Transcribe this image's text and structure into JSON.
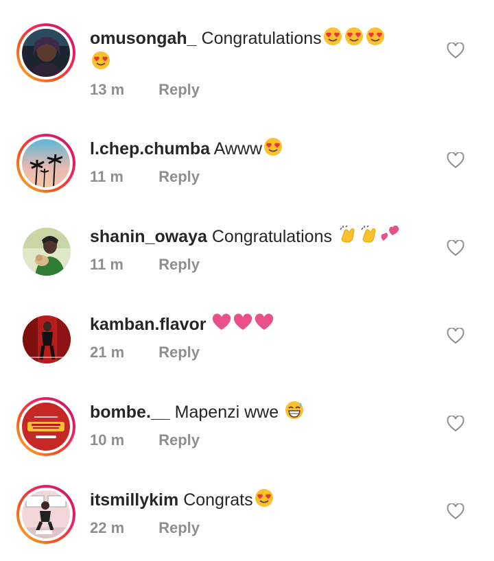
{
  "comments": [
    {
      "username": "omusongah_",
      "text": "Congratulations",
      "emojis": [
        "heart-eyes",
        "heart-eyes",
        "heart-eyes",
        "heart-eyes"
      ],
      "time": "13 m",
      "reply": "Reply",
      "avatar": "dark-portrait",
      "story_ring": true
    },
    {
      "username": "l.chep.chumba",
      "text": "Awww",
      "emojis": [
        "heart-eyes"
      ],
      "time": "11 m",
      "reply": "Reply",
      "avatar": "palm-trees-sunset",
      "story_ring": true
    },
    {
      "username": "shanin_owaya",
      "text": "Congratulations",
      "emojis": [
        "clapping-hands",
        "clapping-hands",
        "two-hearts"
      ],
      "time": "11 m",
      "reply": "Reply",
      "avatar": "person-with-dog",
      "story_ring": false
    },
    {
      "username": "kamban.flavor",
      "text": "",
      "emojis": [
        "pink-heart",
        "pink-heart",
        "pink-heart"
      ],
      "time": "21 m",
      "reply": "Reply",
      "avatar": "person-red-background",
      "story_ring": false
    },
    {
      "username": "bombe.__",
      "text": "Mapenzi wwe",
      "emojis": [
        "grinning-sweat"
      ],
      "time": "10 m",
      "reply": "Reply",
      "avatar": "kalahari-logo",
      "story_ring": true
    },
    {
      "username": "itsmillykim",
      "text": "Congrats",
      "emojis": [
        "heart-eyes"
      ],
      "time": "22 m",
      "reply": "Reply",
      "avatar": "person-pink-wall",
      "story_ring": true
    }
  ],
  "colors": {
    "text": "#262626",
    "meta": "#8e8e8e",
    "heart_emoji": "#e8508a",
    "ring_start": "#fbc02d",
    "ring_end": "#c2185b"
  },
  "icons": {
    "like": "heart-outline-icon"
  }
}
